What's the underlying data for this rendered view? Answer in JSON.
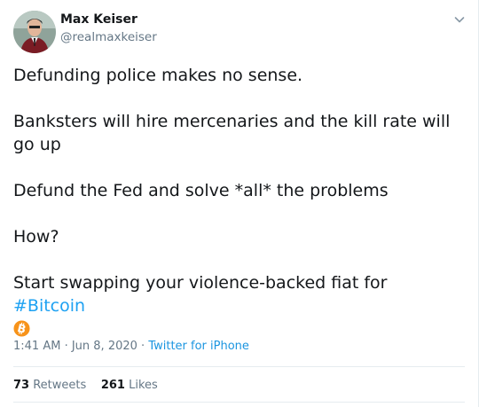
{
  "author": {
    "name": "Max Keiser",
    "handle": "@realmaxkeiser"
  },
  "tweet": {
    "paragraphs": [
      "Defunding police makes no sense.",
      "Banksters will hire mercenaries and the kill rate will go up",
      "Defund the Fed and solve *all* the problems",
      "How?"
    ],
    "final_prefix": "Start swapping your violence-backed fiat for ",
    "hashtag": "#Bitcoin",
    "emoji_icon": "bitcoin-icon"
  },
  "meta": {
    "time": "1:41 AM",
    "separator": " · ",
    "date": "Jun 8, 2020",
    "source": "Twitter for iPhone"
  },
  "stats": {
    "retweets_count": "73",
    "retweets_label": "Retweets",
    "likes_count": "261",
    "likes_label": "Likes"
  },
  "colors": {
    "link": "#1da1f2",
    "muted": "#657786",
    "text": "#14171a",
    "bitcoin": "#f7931a"
  }
}
